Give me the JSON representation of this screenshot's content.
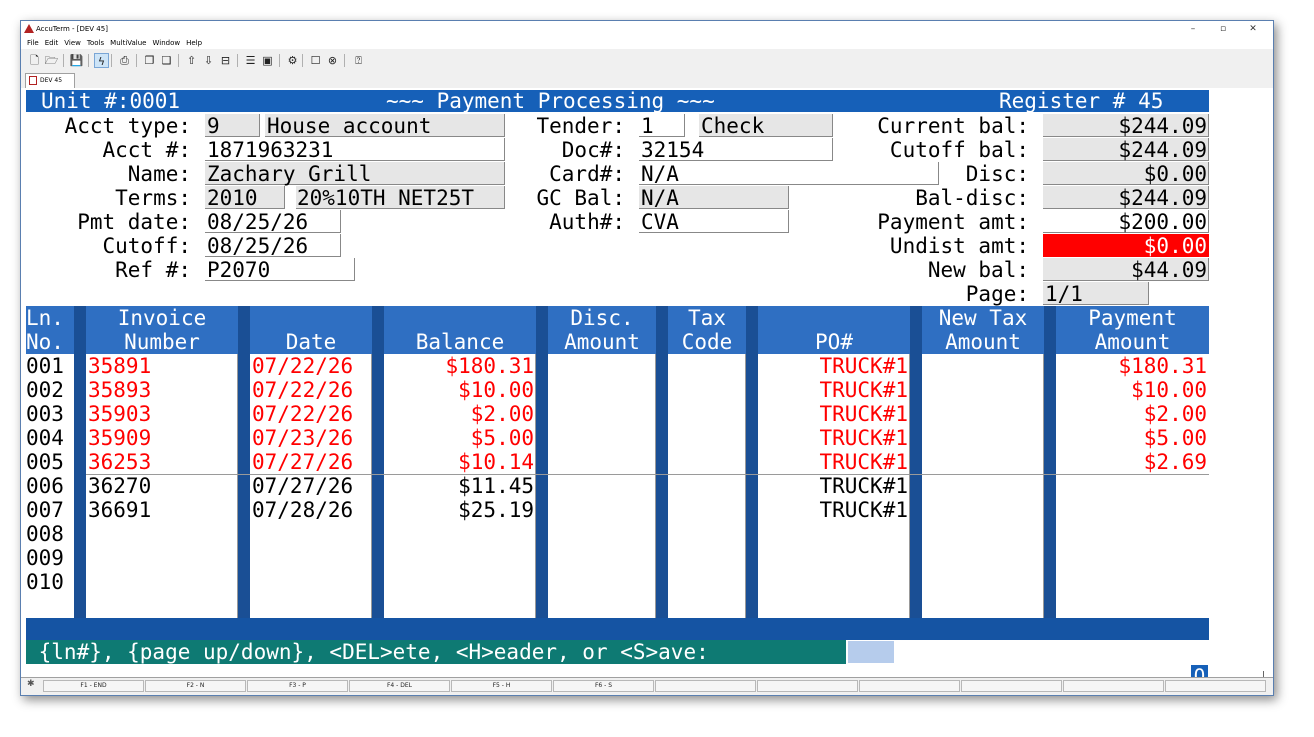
{
  "window": {
    "title": "AccuTerm - [DEV 45]",
    "buttons": {
      "minimize": "–",
      "maximize": "▫",
      "close": "✕"
    }
  },
  "menu": [
    "File",
    "Edit",
    "View",
    "Tools",
    "MultiValue",
    "Window",
    "Help"
  ],
  "toolbar": {
    "icons": [
      "new-icon",
      "open-icon",
      "save-icon",
      "lightning-icon",
      "print-icon",
      "copy-icon",
      "paste-icon",
      "upload-icon",
      "download-icon",
      "drive-icon",
      "file-icon",
      "image-icon",
      "settings-icon",
      "square-icon",
      "close-circle-icon",
      "help-icon"
    ],
    "glyphs": [
      "🗋",
      "🗁",
      "💾",
      "ϟ",
      "⎙",
      "❐",
      "❑",
      "⇧",
      "⇩",
      "⊟",
      "☰",
      "▣",
      "⚙",
      "☐",
      "⊗",
      "⍰"
    ]
  },
  "tab": {
    "label": "DEV 45"
  },
  "screen": {
    "header": {
      "unit": "Unit #:0001",
      "title": "~~~ Payment Processing ~~~",
      "register": "Register # 45"
    },
    "labels": {
      "acct_type": "Acct type:",
      "acct_no": "Acct #:",
      "name": "Name:",
      "terms": "Terms:",
      "pmt_date": "Pmt date:",
      "cutoff": "Cutoff:",
      "ref": "Ref #:",
      "tender": "Tender:",
      "doc": "Doc#:",
      "card": "Card#:",
      "gc_bal": "GC Bal:",
      "auth": "Auth#:",
      "current_bal": "Current bal:",
      "cutoff_bal": "Cutoff bal:",
      "disc": "Disc:",
      "bal_disc": "Bal-disc:",
      "payment_amt": "Payment amt:",
      "undist_amt": "Undist amt:",
      "new_bal": "New bal:",
      "page": "Page:"
    },
    "values": {
      "acct_type_code": "9",
      "acct_type_desc": "House account",
      "acct_no": "1871963231",
      "name": "Zachary Grill",
      "terms_code": "2010",
      "terms_desc": "20%10TH NET25T",
      "pmt_date": "08/25/26",
      "cutoff": "08/25/26",
      "ref": "P2070",
      "tender_code": "1",
      "tender_desc": "Check",
      "doc": "32154",
      "card": "N/A",
      "gc_bal": "N/A",
      "auth": "CVA",
      "current_bal": "$244.09",
      "cutoff_bal": "$244.09",
      "disc": "$0.00",
      "bal_disc": "$244.09",
      "payment_amt": "$200.00",
      "undist_amt": "$0.00",
      "new_bal": "$44.09",
      "page": "1/1"
    },
    "columns": {
      "ln": [
        "Ln.",
        "No."
      ],
      "invoice": [
        "Invoice",
        "Number"
      ],
      "date": [
        "",
        "Date"
      ],
      "balance": [
        "",
        "Balance"
      ],
      "disc": [
        "Disc.",
        "Amount"
      ],
      "tax": [
        "Tax",
        "Code"
      ],
      "po": [
        "",
        "PO#"
      ],
      "newtax": [
        "New Tax",
        "Amount"
      ],
      "payment": [
        "Payment",
        "Amount"
      ]
    },
    "rows": [
      {
        "ln": "001",
        "invoice": "35891",
        "date": "07/22/26",
        "balance": "$180.31",
        "po": "TRUCK#1",
        "payment": "$180.31",
        "highlight": true
      },
      {
        "ln": "002",
        "invoice": "35893",
        "date": "07/22/26",
        "balance": "$10.00",
        "po": "TRUCK#1",
        "payment": "$10.00",
        "highlight": true
      },
      {
        "ln": "003",
        "invoice": "35903",
        "date": "07/22/26",
        "balance": "$2.00",
        "po": "TRUCK#1",
        "payment": "$2.00",
        "highlight": true
      },
      {
        "ln": "004",
        "invoice": "35909",
        "date": "07/23/26",
        "balance": "$5.00",
        "po": "TRUCK#1",
        "payment": "$5.00",
        "highlight": true
      },
      {
        "ln": "005",
        "invoice": "36253",
        "date": "07/27/26",
        "balance": "$10.14",
        "po": "TRUCK#1",
        "payment": "$2.69",
        "highlight": true
      },
      {
        "ln": "006",
        "invoice": "36270",
        "date": "07/27/26",
        "balance": "$11.45",
        "po": "TRUCK#1",
        "payment": "",
        "highlight": false
      },
      {
        "ln": "007",
        "invoice": "36691",
        "date": "07/28/26",
        "balance": "$25.19",
        "po": "TRUCK#1",
        "payment": "",
        "highlight": false
      },
      {
        "ln": "008",
        "invoice": "",
        "date": "",
        "balance": "",
        "po": "",
        "payment": "",
        "highlight": false
      },
      {
        "ln": "009",
        "invoice": "",
        "date": "",
        "balance": "",
        "po": "",
        "payment": "",
        "highlight": false
      },
      {
        "ln": "010",
        "invoice": "",
        "date": "",
        "balance": "",
        "po": "",
        "payment": "",
        "highlight": false
      }
    ],
    "prompt": " {ln#}, {page up/down}, <DEL>ete, <H>eader, or <S>ave:",
    "cursor_char": "O",
    "colors": {
      "header_bar": "#1660b8",
      "column_header": "#2f6fc2",
      "prompt_bg": "#0e7a73",
      "alert": "#ff0000"
    }
  },
  "function_keys": [
    "F1 - END",
    "F2 - N",
    "F3 - P",
    "F4 - DEL",
    "F5 - H",
    "F6 - S",
    "",
    "",
    "",
    "",
    "",
    ""
  ]
}
